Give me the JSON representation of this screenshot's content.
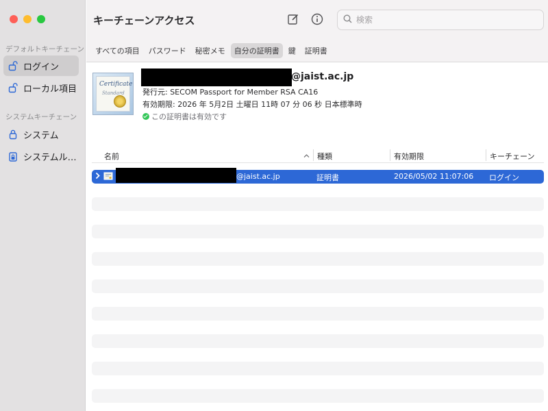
{
  "window": {
    "title": "キーチェーンアクセス"
  },
  "sidebar": {
    "default_section": "デフォルトキーチェーン",
    "system_section": "システムキーチェーン",
    "items": [
      {
        "label": "ログイン",
        "icon": "lock-open-icon",
        "active": true
      },
      {
        "label": "ローカル項目",
        "icon": "lock-open-icon",
        "active": false
      },
      {
        "label": "システム",
        "icon": "lock-icon",
        "active": false
      },
      {
        "label": "システムルート",
        "icon": "lock-cabinet-icon",
        "active": false
      }
    ]
  },
  "toolbar": {
    "new_item_icon": "compose-icon",
    "info_icon": "info-icon",
    "search_placeholder": "検索"
  },
  "tabs": [
    {
      "label": "すべての項目",
      "active": false
    },
    {
      "label": "パスワード",
      "active": false
    },
    {
      "label": "秘密メモ",
      "active": false
    },
    {
      "label": "自分の証明書",
      "active": true
    },
    {
      "label": "鍵",
      "active": false
    },
    {
      "label": "証明書",
      "active": false
    }
  ],
  "detail": {
    "image_word": "Certificate",
    "image_word2": "Standard",
    "name_suffix": "@jaist.ac.jp",
    "issuer": "発行元: SECOM Passport for Member RSA CA16",
    "expires": "有効期限: 2026 年 5月2日 土曜日 11時 07 分 06 秒 日本標準時",
    "validity": "この証明書は有効です"
  },
  "table": {
    "columns": [
      "名前",
      "種類",
      "有効期限",
      "キーチェーン"
    ],
    "rows": [
      {
        "name_suffix": "@jaist.ac.jp",
        "kind": "証明書",
        "expires": "2026/05/02 11:07:06",
        "keychain": "ログイン",
        "selected": true
      }
    ]
  },
  "colors": {
    "selection": "#2d68d6",
    "valid_green": "#35c759",
    "close": "#fe5f57",
    "minimize": "#febc2e",
    "maximize": "#28c840"
  }
}
